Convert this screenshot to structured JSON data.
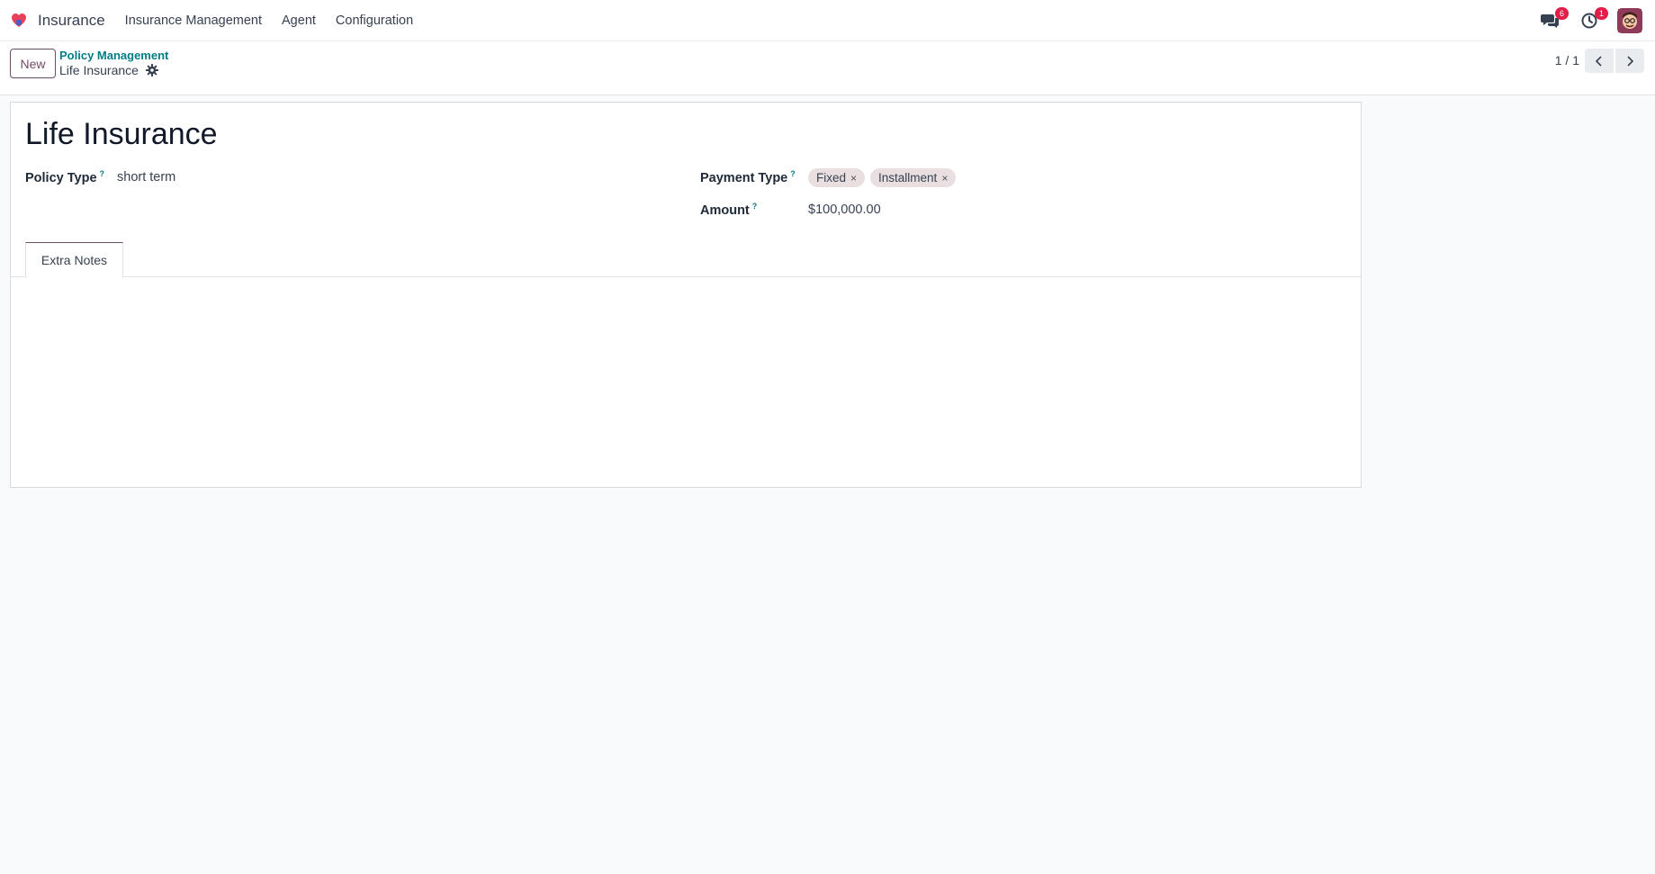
{
  "navbar": {
    "brand": "Insurance",
    "menu": [
      "Insurance Management",
      "Agent",
      "Configuration"
    ],
    "messages_badge": "6",
    "activities_badge": "1"
  },
  "control_panel": {
    "new_label": "New",
    "breadcrumb_parent": "Policy Management",
    "breadcrumb_current": "Life Insurance",
    "pager": "1 / 1"
  },
  "form": {
    "title": "Life Insurance",
    "policy_type_label": "Policy Type",
    "policy_type_value": "short term",
    "payment_type_label": "Payment Type",
    "payment_tags": [
      "Fixed",
      "Installment"
    ],
    "amount_label": "Amount",
    "amount_value": "$100,000.00",
    "help_mark": "?",
    "tag_remove": "×"
  },
  "tabs": [
    "Extra Notes"
  ]
}
